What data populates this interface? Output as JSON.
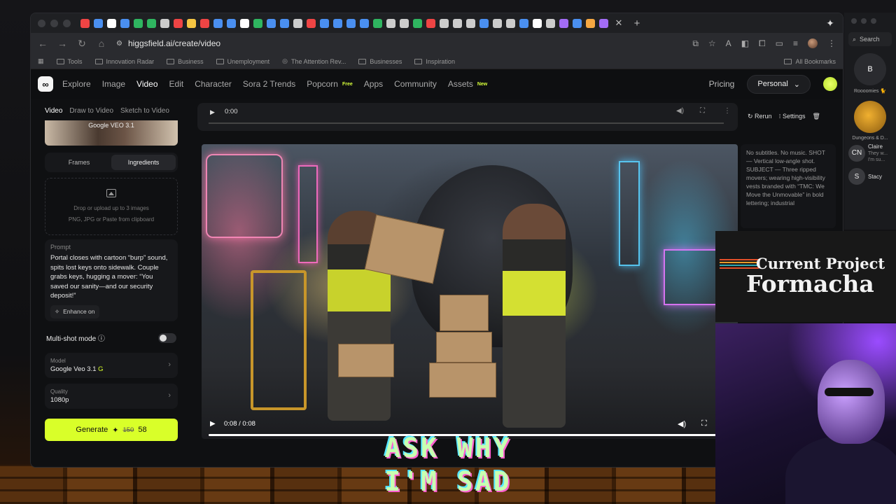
{
  "browser": {
    "url": "higgsfield.ai/create/video",
    "bookmarks": [
      "Tools",
      "Innovation Radar",
      "Business",
      "Unemployment",
      "The Attention Rev...",
      "Businesses",
      "Inspiration"
    ],
    "all_bookmarks": "All Bookmarks",
    "favicon_colors": [
      "#e44",
      "#4a8ff0",
      "#fff",
      "#4a8ff0",
      "#2fb560",
      "#2fb560",
      "#ccc",
      "#e44",
      "#f5c542",
      "#e44",
      "#4a8ff0",
      "#4a8ff0",
      "#fff",
      "#2fb560",
      "#4a8ff0",
      "#4a8ff0",
      "#ccc",
      "#e44",
      "#4a8ff0",
      "#4a8ff0",
      "#4a8ff0",
      "#4a8ff0",
      "#2fb560",
      "#ccc",
      "#ccc",
      "#2fb560",
      "#e44",
      "#ccc",
      "#ccc",
      "#ccc",
      "#4a8ff0",
      "#ccc",
      "#ccc",
      "#4a8ff0",
      "#fff",
      "#ccc",
      "#a26cf5",
      "#4a8ff0",
      "#f5a742",
      "#a26cf5"
    ]
  },
  "nav": {
    "items": [
      "Explore",
      "Image",
      "Video",
      "Edit",
      "Character",
      "Sora 2 Trends",
      "Popcorn",
      "Apps",
      "Community",
      "Assets"
    ],
    "popcorn_tag": "Free",
    "assets_tag": "New",
    "pricing": "Pricing",
    "workspace": "Personal"
  },
  "left": {
    "mode_tabs": [
      "Video",
      "Draw to Video",
      "Sketch to Video"
    ],
    "thumb_label": "Google VEO 3.1",
    "segments": [
      "Frames",
      "Ingredients"
    ],
    "drop_line1": "Drop or upload up to 3 images",
    "drop_line2": "PNG, JPG or Paste from clipboard",
    "prompt_label": "Prompt",
    "prompt_text": "Portal closes with cartoon “burp” sound, spits lost keys onto sidewalk. Couple grabs keys, hugging a mover: “You saved our sanity—and our security deposit!”",
    "enhance": "Enhance on",
    "multishot": "Multi-shot mode",
    "model_label": "Model",
    "model_value": "Google Veo 3.1",
    "quality_label": "Quality",
    "quality_value": "1080p",
    "generate": "Generate",
    "old_credits": "150",
    "credits": "58"
  },
  "player": {
    "audio_time": "0:00",
    "rerun": "Rerun",
    "settings": "Settings",
    "video_time": "0:08 / 0:08",
    "description": "No subtitles. No music. SHOT — Vertical low-angle shot. SUBJECT — Three ripped movers; wearing high-visibility vests branded with “TMC: We Move the Unmovable” in bold lettering; industrial"
  },
  "overlay": {
    "caption_line1": "ASK WHY",
    "caption_line2": "I'M SAD",
    "project_line1": "Current Project",
    "project_line2": "Formacha"
  },
  "chat": {
    "search": "Search",
    "contacts": [
      {
        "initials": "B",
        "name": "Roooomies 🐈"
      },
      {
        "initials": "",
        "name": "Dungeons & D..."
      }
    ],
    "rows": [
      {
        "initials": "CN",
        "name": "Claire",
        "preview": "They w... I'm su..."
      },
      {
        "initials": "S",
        "name": "Stacy",
        "preview": ""
      }
    ]
  }
}
